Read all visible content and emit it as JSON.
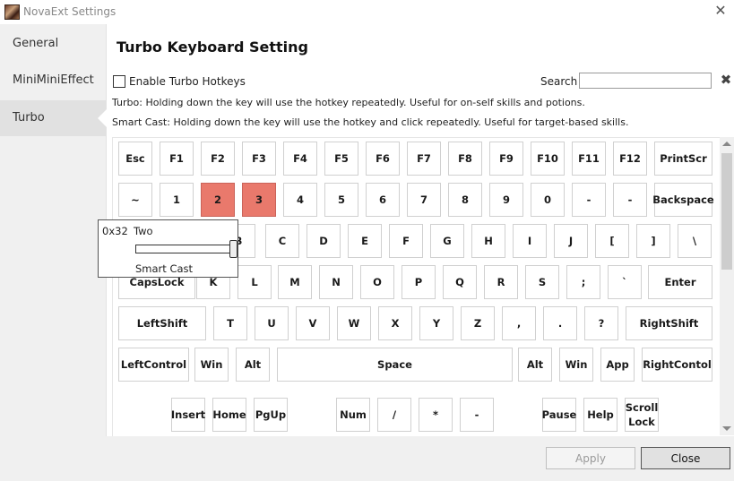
{
  "window": {
    "title": "NovaExt Settings"
  },
  "sidebar": {
    "items": [
      {
        "label": "General"
      },
      {
        "label": "MiniMiniEffect"
      },
      {
        "label": "Turbo"
      }
    ]
  },
  "page": {
    "title": "Turbo Keyboard Setting"
  },
  "toolbar": {
    "enable_label": "Enable Turbo Hotkeys",
    "enable_checked": false,
    "search_label": "Search",
    "search_value": ""
  },
  "descriptions": {
    "turbo": "Turbo: Holding down the key will use the hotkey repeatedly. Useful for on-self skills and potions.",
    "smart_cast": "Smart Cast: Holding down the key will use the hotkey and click repeatedly. Useful for target-based skills."
  },
  "keyboard": {
    "highlight_color": "#e9796c",
    "rows": [
      [
        "Esc",
        "F1",
        "F2",
        "F3",
        "F4",
        "F5",
        "F6",
        "F7",
        "F8",
        "F9",
        "F10",
        "F11",
        "F12",
        "PrintScr"
      ],
      [
        "~",
        "1",
        "2",
        "3",
        "4",
        "5",
        "6",
        "7",
        "8",
        "9",
        "0",
        "-",
        "-",
        "Backspace"
      ],
      [
        "B",
        "C",
        "D",
        "E",
        "F",
        "G",
        "H",
        "I",
        "J",
        "[",
        "]",
        "\\"
      ],
      [
        "CapsLock",
        "K",
        "L",
        "M",
        "N",
        "O",
        "P",
        "Q",
        "R",
        "S",
        ";",
        "`",
        "Enter"
      ],
      [
        "LeftShift",
        "T",
        "U",
        "V",
        "W",
        "X",
        "Y",
        "Z",
        ",",
        ".",
        "?",
        "RightShift"
      ],
      [
        "LeftControl",
        "Win",
        "Alt",
        "Space",
        "Alt",
        "Win",
        "App",
        "RightContol"
      ],
      [
        "Insert",
        "Home",
        "PgUp",
        "Num",
        "/",
        "*",
        "-",
        "Pause",
        "Help",
        "Scroll Lock"
      ]
    ],
    "highlighted": [
      "2",
      "3"
    ]
  },
  "popup": {
    "code": "0x32",
    "name": "Two",
    "slider_value": 1.0,
    "label": "Smart Cast"
  },
  "footer": {
    "apply_label": "Apply",
    "apply_enabled": false,
    "close_label": "Close"
  }
}
